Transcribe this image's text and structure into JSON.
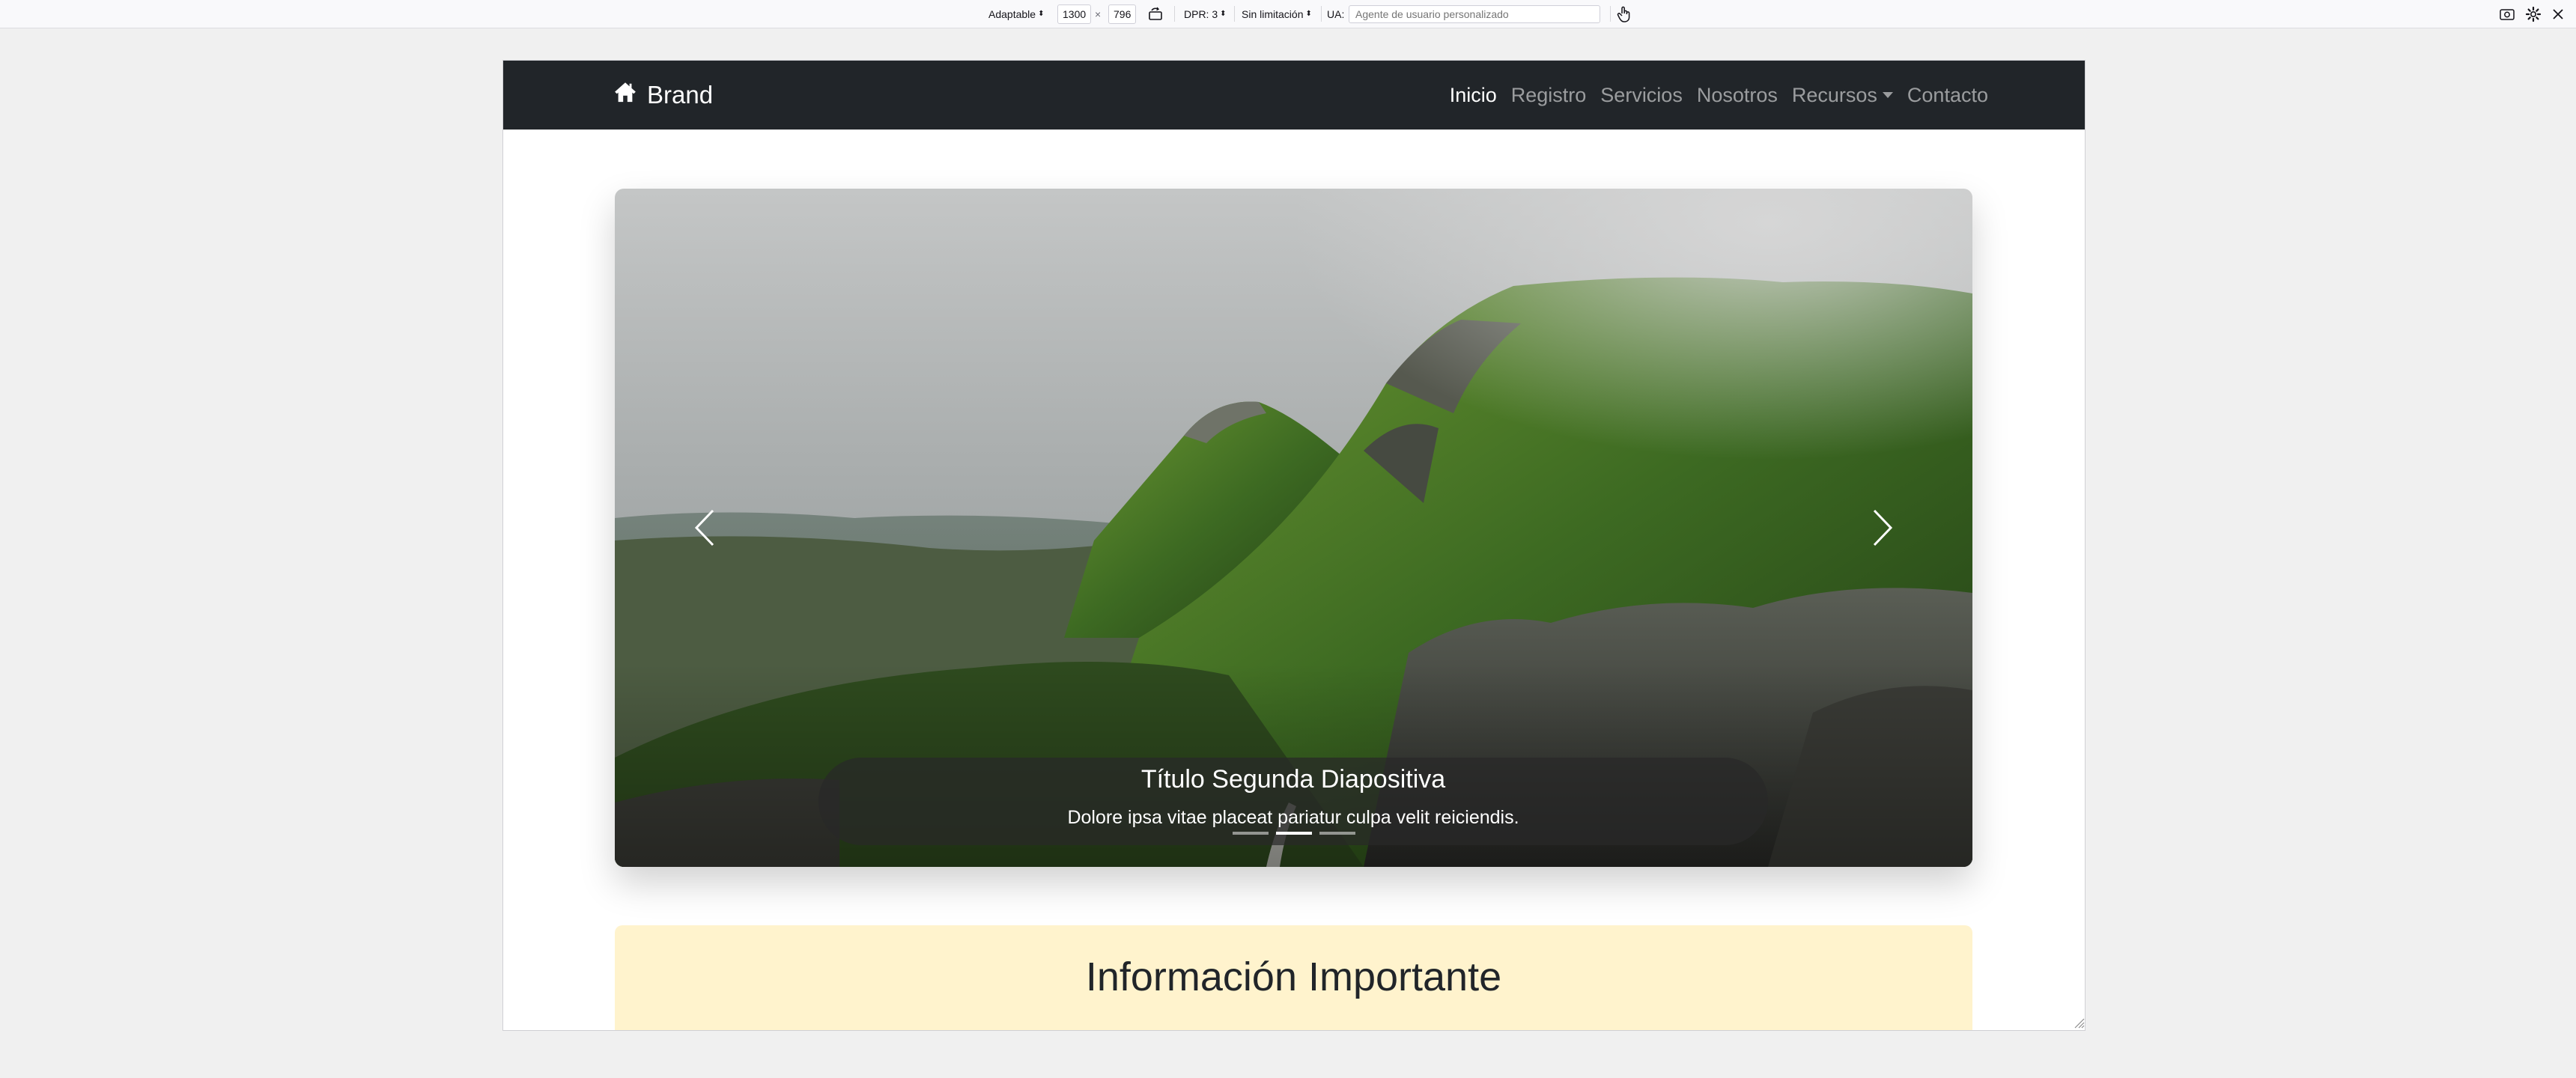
{
  "devtools": {
    "device_label": "Adaptable",
    "width": "1300",
    "times": "×",
    "height": "796",
    "dpr_label": "DPR: 3",
    "throttle_label": "Sin limitación",
    "ua_label": "UA:",
    "ua_placeholder": "Agente de usuario personalizado"
  },
  "navbar": {
    "brand": "Brand",
    "items": [
      {
        "label": "Inicio",
        "active": true
      },
      {
        "label": "Registro"
      },
      {
        "label": "Servicios"
      },
      {
        "label": "Nosotros"
      },
      {
        "label": "Recursos",
        "dropdown": true
      },
      {
        "label": "Contacto"
      }
    ]
  },
  "carousel": {
    "caption_title": "Título Segunda Diapositiva",
    "caption_text": "Dolore ipsa vitae placeat pariatur culpa velit reiciendis.",
    "slide_count": 3,
    "active_index": 1
  },
  "alert": {
    "heading": "Información Importante"
  },
  "colors": {
    "navbar_bg": "#212529",
    "alert_bg": "#fff3cd",
    "page_bg": "#f0f0f0"
  }
}
